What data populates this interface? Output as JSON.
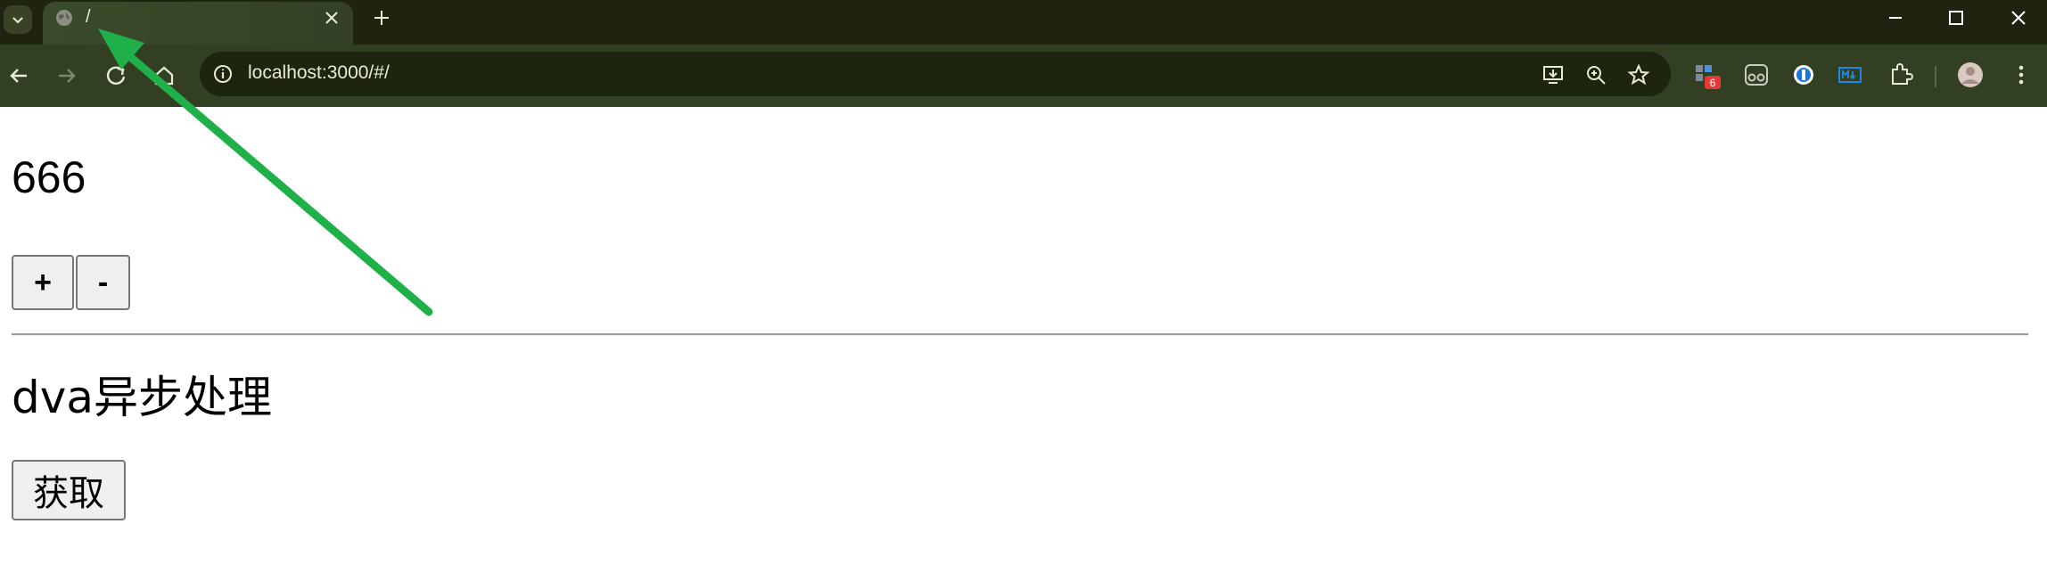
{
  "browser": {
    "tab": {
      "title": "/",
      "favicon": "globe-icon"
    },
    "address_bar": {
      "url": "localhost:3000/#/"
    },
    "extension_badge": "6",
    "colors": {
      "frame": "#1f2410",
      "toolbar": "#333f22",
      "omnibox": "#1d240f",
      "badge": "#e53935",
      "annotation_arrow": "#1fb04a"
    }
  },
  "page": {
    "count": "666",
    "increment_label": "+",
    "decrement_label": "-",
    "async_heading": "dva异步处理",
    "fetch_label": "获取"
  }
}
